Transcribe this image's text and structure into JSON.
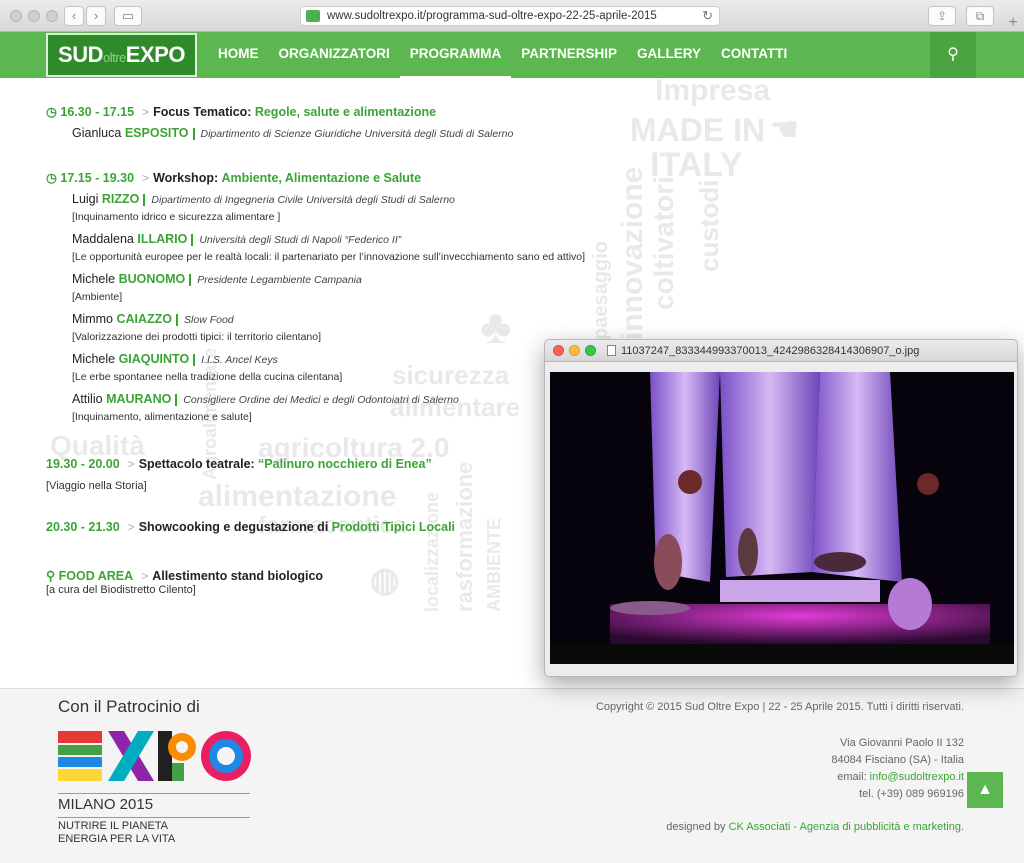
{
  "browser": {
    "url": "www.sudoltrexpo.it/programma-sud-oltre-expo-22-25-aprile-2015"
  },
  "site": {
    "logo": {
      "part1": "SUD",
      "part2": "oltre",
      "part3": "EXPO"
    },
    "menu": [
      "HOME",
      "ORGANIZZATORI",
      "PROGRAMMA",
      "PARTNERSHIP",
      "GALLERY",
      "CONTATTI"
    ],
    "active_menu": "PROGRAMMA"
  },
  "watermark": [
    "Impresa",
    "MADE IN",
    "ITALY",
    "coltivatori",
    "custodi",
    "innovazione",
    "paesaggio",
    "sicurezza",
    "alimentare",
    "agricoltura 2.0",
    "alimentazione",
    "Qualità",
    "farmaceutica",
    "rasformazione",
    "localizzazione",
    "AMBIENTE",
    "Agroalimentare"
  ],
  "program": [
    {
      "time": "16.30 - 17.15",
      "label": "Focus Tematico:",
      "title": "Regole, salute e alimentazione",
      "speakers": [
        {
          "first": "Gianluca",
          "last": "ESPOSITO",
          "aff": "Dipartimento di Scienze Giuridiche Università degli Studi di Salerno",
          "note": ""
        }
      ]
    },
    {
      "time": "17.15 - 19.30",
      "label": "Workshop:",
      "title": "Ambiente, Alimentazione e Salute",
      "speakers": [
        {
          "first": "Luigi",
          "last": "RIZZO",
          "aff": "Dipartimento di Ingegneria Civile Università degli Studi di Salerno",
          "note": "[Inquinamento idrico e sicurezza alimentare ]"
        },
        {
          "first": "Maddalena",
          "last": "ILLARIO",
          "aff": "Università degli Studi di Napoli “Federico II”",
          "note": "[Le opportunità europee per le realtà locali: il partenariato per l’innovazione sull’invecchiamento sano ed attivo]"
        },
        {
          "first": "Michele",
          "last": "BUONOMO",
          "aff": "Presidente Legambiente Campania",
          "note": "[Ambiente]"
        },
        {
          "first": "Mimmo",
          "last": "CAIAZZO",
          "aff": "Slow Food",
          "note": "[Valorizzazione dei prodotti tipici: il territorio cilentano]"
        },
        {
          "first": "Michele",
          "last": "GIAQUINTO",
          "aff": "I.I.S. Ancel Keys",
          "note": "[Le erbe spontanee nella tradizione della cucina cilentana]"
        },
        {
          "first": "Attilio",
          "last": "MAURANO",
          "aff": "Consigliere Ordine dei Medici e degli Odontoiatri di Salerno",
          "note": "[Inquinamento, alimentazione e salute]"
        }
      ]
    },
    {
      "time": "19.30 - 20.00",
      "label": "Spettacolo teatrale:",
      "title": "“Palinuro nocchiero di Enea”",
      "subnote": "[Viaggio nella Storia]"
    },
    {
      "time": "20.30 - 21.30",
      "label": "Showcooking e degustazione di",
      "title": "Prodotti Tipici Locali"
    },
    {
      "time": "FOOD AREA",
      "label": "Allestimento stand biologico",
      "title": "",
      "subnote": "[a cura del Biodistretto Cilento]"
    }
  ],
  "footer": {
    "patrocinio": "Con il Patrocinio di",
    "milano": "MILANO 2015",
    "nutrire1": "NUTRIRE IL PIANETA",
    "nutrire2": "ENERGIA PER LA VITA",
    "copyright": "Copyright © 2015 Sud Oltre Expo | 22 - 25 Aprile 2015. Tutti i diritti riservati.",
    "addr1": "Via Giovanni Paolo II 132",
    "addr2": "84084 Fisciano (SA) - Italia",
    "email_label": "email: ",
    "email": "info@sudoltrexpo.it",
    "tel": "tel. (+39) 089 969196",
    "design_label": "designed by ",
    "design_link": "CK Associati - Agenzia di pubblicità e marketing",
    "design_end": "."
  },
  "preview": {
    "filename": "11037247_833344993370013_4242986328414306907_o.jpg"
  },
  "colors": {
    "green": "#5cb750",
    "dark_green": "#2f8a2a",
    "accent": "#3aa535"
  }
}
